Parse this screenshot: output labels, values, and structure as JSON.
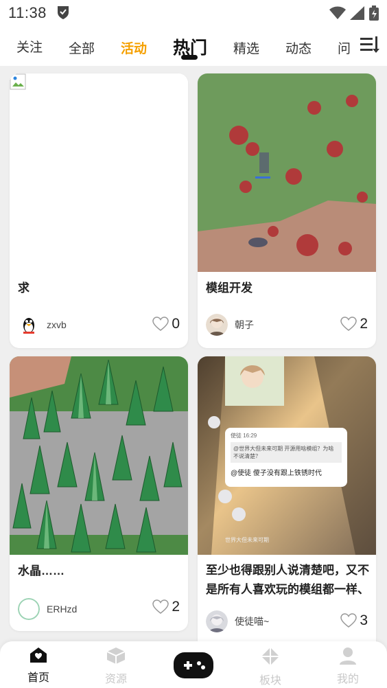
{
  "status": {
    "time": "11:38"
  },
  "tabs": [
    {
      "label": "关注"
    },
    {
      "label": "全部"
    },
    {
      "label": "活动"
    },
    {
      "label": "热门"
    },
    {
      "label": "精选"
    },
    {
      "label": "动态"
    },
    {
      "label": "问"
    }
  ],
  "active_tab": "热门",
  "posts": [
    {
      "title": "求",
      "user": "zxvb",
      "likes": "0"
    },
    {
      "title": "模组开发",
      "user": "朝子",
      "likes": "2"
    },
    {
      "title": "水晶……",
      "user": "ERHzd",
      "likes": "2"
    },
    {
      "title": "至少也得跟别人说清楚吧，又不是所有人喜欢玩的模组都一样、",
      "user": "使徒喵~",
      "likes": "3"
    }
  ],
  "screenshot_chat": {
    "sender": "使徒",
    "time": "16:29",
    "quote": "@世界大但未来可期 开源用啥模组？为啥不说清楚？",
    "reply": "@使徒 傻子没有跟上铁锈时代",
    "footer_name": "世界大但未来可期"
  },
  "nav": [
    {
      "label": "首页"
    },
    {
      "label": "资源"
    },
    {
      "label": "板块"
    },
    {
      "label": "我的"
    }
  ],
  "colors": {
    "accent_orange": "#f5a000",
    "active_text": "#111111",
    "inactive_nav": "#c8c8c8",
    "background": "#efefef"
  }
}
